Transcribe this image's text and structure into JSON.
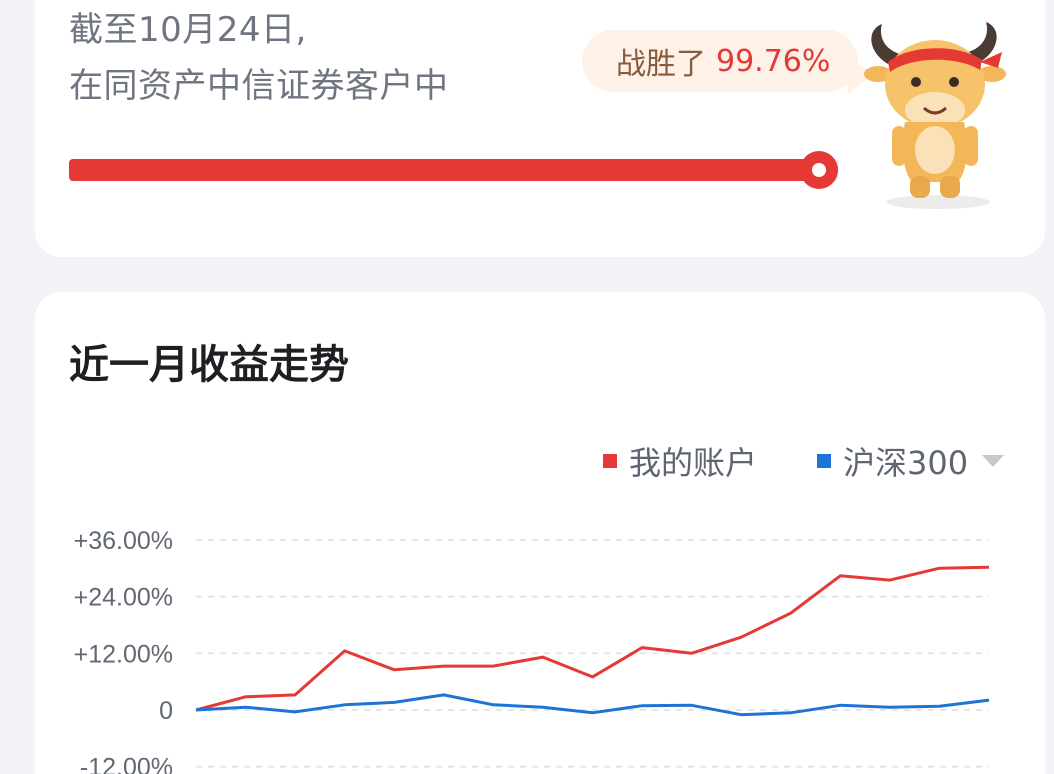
{
  "rank": {
    "line1": "截至10月24日,",
    "line2": "在同资产中信证券客户中",
    "bubble_label": "战胜了",
    "bubble_value": "99.76%",
    "percentile": 0.9976
  },
  "trend": {
    "title": "近一月收益走势",
    "legend": [
      {
        "label": "我的账户",
        "color": "#e53935",
        "icon": "red-square"
      },
      {
        "label": "沪深300",
        "color": "#1e73d6",
        "icon": "blue-square"
      }
    ],
    "dropdown_icon": "caret-down-icon"
  },
  "chart_data": {
    "type": "line",
    "yticks": [
      "+36.00%",
      "+24.00%",
      "+12.00%",
      "0",
      "-12.00%"
    ],
    "ytick_values": [
      36,
      24,
      12,
      0,
      -12
    ],
    "ylim": [
      -12,
      36
    ],
    "grid": true,
    "legend_position": "top-right",
    "series": [
      {
        "name": "我的账户",
        "color": "#e53935",
        "values": [
          0,
          2.8,
          3.2,
          12.5,
          8.5,
          9.3,
          9.3,
          11.2,
          7.0,
          13.2,
          12.0,
          15.4,
          20.5,
          28.4,
          27.5,
          30.0,
          30.2
        ]
      },
      {
        "name": "沪深300",
        "color": "#1e73d6",
        "values": [
          0,
          0.6,
          -0.4,
          1.1,
          1.6,
          3.2,
          1.1,
          0.6,
          -0.6,
          0.9,
          1.0,
          -1.0,
          -0.6,
          1.0,
          0.6,
          0.8,
          2.1
        ]
      }
    ]
  }
}
